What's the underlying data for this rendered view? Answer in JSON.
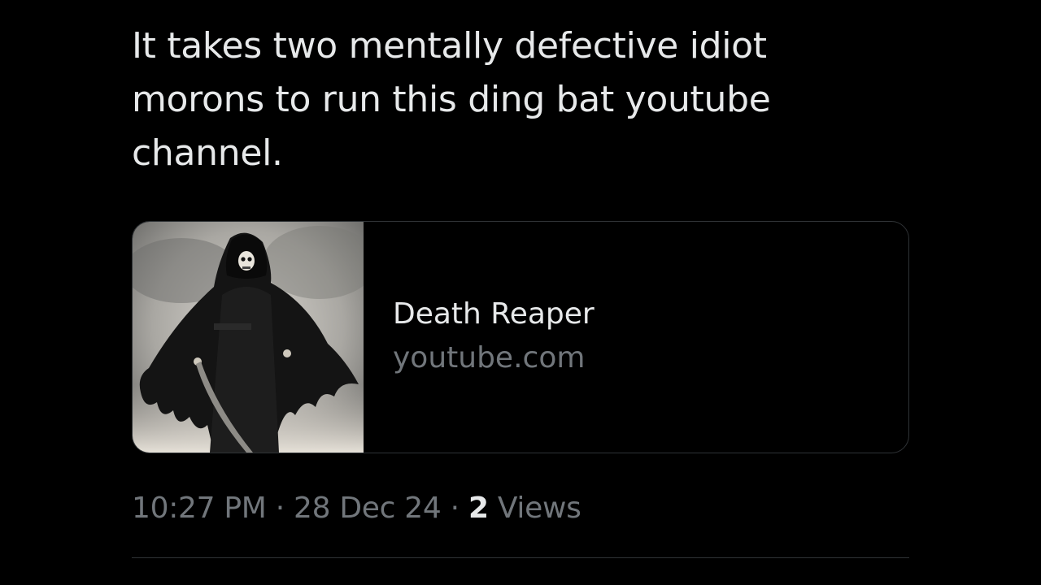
{
  "tweet": {
    "text": "It takes two mentally defective idiot morons to run this ding bat youtube channel."
  },
  "link_card": {
    "title": "Death Reaper",
    "domain": "youtube.com",
    "thumbnail": "grim-reaper-artwork"
  },
  "meta": {
    "time": "10:27 PM",
    "separator": "·",
    "date": "28 Dec 24",
    "views_count": "2",
    "views_label": "Views"
  },
  "colors": {
    "background": "#000000",
    "primary_text": "#e7e9ea",
    "secondary_text": "#71767b",
    "border": "#2f3336"
  }
}
